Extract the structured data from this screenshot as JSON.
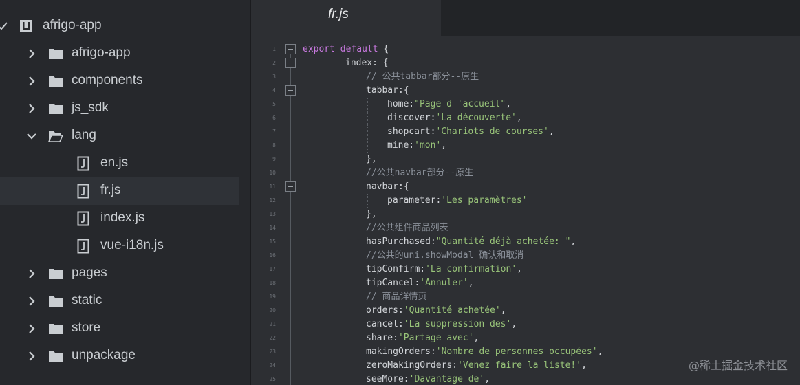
{
  "sidebar": {
    "items": [
      {
        "label": "afrigo-app",
        "type": "project",
        "chevron": "check",
        "depth": 0
      },
      {
        "label": "afrigo-app",
        "type": "folder",
        "chevron": "right",
        "depth": 1
      },
      {
        "label": "components",
        "type": "folder",
        "chevron": "right",
        "depth": 1
      },
      {
        "label": "js_sdk",
        "type": "folder",
        "chevron": "right",
        "depth": 1
      },
      {
        "label": "lang",
        "type": "folder-open",
        "chevron": "down",
        "depth": 1
      },
      {
        "label": "en.js",
        "type": "file",
        "chevron": "none",
        "depth": 2
      },
      {
        "label": "fr.js",
        "type": "file",
        "chevron": "none",
        "depth": 2,
        "selected": true
      },
      {
        "label": "index.js",
        "type": "file",
        "chevron": "none",
        "depth": 2
      },
      {
        "label": "vue-i18n.js",
        "type": "file",
        "chevron": "none",
        "depth": 2
      },
      {
        "label": "pages",
        "type": "folder",
        "chevron": "right",
        "depth": 1
      },
      {
        "label": "static",
        "type": "folder",
        "chevron": "right",
        "depth": 1
      },
      {
        "label": "store",
        "type": "folder",
        "chevron": "right",
        "depth": 1
      },
      {
        "label": "unpackage",
        "type": "folder",
        "chevron": "right",
        "depth": 1
      }
    ]
  },
  "tab": {
    "title": "fr.js"
  },
  "editor": {
    "lines": [
      {
        "n": "1",
        "indent": 0,
        "fold": "open",
        "parts": [
          {
            "t": "export default",
            "c": "kw"
          },
          {
            "t": " {",
            "c": "pl"
          }
        ]
      },
      {
        "n": "2",
        "indent": 1,
        "fold": "open",
        "parts": [
          {
            "t": "index: {",
            "c": "pl"
          }
        ]
      },
      {
        "n": "3",
        "indent": 2,
        "fold": "",
        "parts": [
          {
            "t": "// 公共tabbar部分--原生",
            "c": "cm"
          }
        ]
      },
      {
        "n": "4",
        "indent": 2,
        "fold": "open",
        "parts": [
          {
            "t": "tabbar:{",
            "c": "pl"
          }
        ]
      },
      {
        "n": "5",
        "indent": 3,
        "fold": "",
        "parts": [
          {
            "t": "home:",
            "c": "pl"
          },
          {
            "t": "\"Page d 'accueil\"",
            "c": "str"
          },
          {
            "t": ",",
            "c": "pl"
          }
        ]
      },
      {
        "n": "6",
        "indent": 3,
        "fold": "",
        "parts": [
          {
            "t": "discover:",
            "c": "pl"
          },
          {
            "t": "'La découverte'",
            "c": "str"
          },
          {
            "t": ",",
            "c": "pl"
          }
        ]
      },
      {
        "n": "7",
        "indent": 3,
        "fold": "",
        "parts": [
          {
            "t": "shopcart:",
            "c": "pl"
          },
          {
            "t": "'Chariots de courses'",
            "c": "str"
          },
          {
            "t": ",",
            "c": "pl"
          }
        ]
      },
      {
        "n": "8",
        "indent": 3,
        "fold": "",
        "parts": [
          {
            "t": "mine:",
            "c": "pl"
          },
          {
            "t": "'mon'",
            "c": "str"
          },
          {
            "t": ",",
            "c": "pl"
          }
        ]
      },
      {
        "n": "9",
        "indent": 2,
        "fold": "end",
        "parts": [
          {
            "t": "},",
            "c": "pl"
          }
        ]
      },
      {
        "n": "10",
        "indent": 2,
        "fold": "",
        "parts": [
          {
            "t": "//公共navbar部分--原生",
            "c": "cm"
          }
        ]
      },
      {
        "n": "11",
        "indent": 2,
        "fold": "open",
        "parts": [
          {
            "t": "navbar:{",
            "c": "pl"
          }
        ]
      },
      {
        "n": "12",
        "indent": 3,
        "fold": "",
        "parts": [
          {
            "t": "parameter:",
            "c": "pl"
          },
          {
            "t": "'Les paramètres'",
            "c": "str"
          }
        ]
      },
      {
        "n": "13",
        "indent": 2,
        "fold": "end",
        "parts": [
          {
            "t": "},",
            "c": "pl"
          }
        ]
      },
      {
        "n": "14",
        "indent": 2,
        "fold": "",
        "parts": [
          {
            "t": "//公共组件商品列表",
            "c": "cm"
          }
        ]
      },
      {
        "n": "15",
        "indent": 2,
        "fold": "",
        "parts": [
          {
            "t": "hasPurchased:",
            "c": "pl"
          },
          {
            "t": "\"Quantité déjà achetée: \"",
            "c": "str"
          },
          {
            "t": ",",
            "c": "pl"
          }
        ]
      },
      {
        "n": "16",
        "indent": 2,
        "fold": "",
        "parts": [
          {
            "t": "//公共的uni.showModal 确认和取消",
            "c": "cm"
          }
        ]
      },
      {
        "n": "17",
        "indent": 2,
        "fold": "",
        "parts": [
          {
            "t": "tipConfirm:",
            "c": "pl"
          },
          {
            "t": "'La confirmation'",
            "c": "str"
          },
          {
            "t": ",",
            "c": "pl"
          }
        ]
      },
      {
        "n": "18",
        "indent": 2,
        "fold": "",
        "parts": [
          {
            "t": "tipCancel:",
            "c": "pl"
          },
          {
            "t": "'Annuler'",
            "c": "str"
          },
          {
            "t": ",",
            "c": "pl"
          }
        ]
      },
      {
        "n": "19",
        "indent": 2,
        "fold": "",
        "parts": [
          {
            "t": "// 商品详情页",
            "c": "cm"
          }
        ]
      },
      {
        "n": "20",
        "indent": 2,
        "fold": "",
        "parts": [
          {
            "t": "orders:",
            "c": "pl"
          },
          {
            "t": "'Quantité achetée'",
            "c": "str"
          },
          {
            "t": ",",
            "c": "pl"
          }
        ]
      },
      {
        "n": "21",
        "indent": 2,
        "fold": "",
        "parts": [
          {
            "t": "cancel:",
            "c": "pl"
          },
          {
            "t": "'La suppression des'",
            "c": "str"
          },
          {
            "t": ",",
            "c": "pl"
          }
        ]
      },
      {
        "n": "22",
        "indent": 2,
        "fold": "",
        "parts": [
          {
            "t": "share:",
            "c": "pl"
          },
          {
            "t": "'Partage avec'",
            "c": "str"
          },
          {
            "t": ",",
            "c": "pl"
          }
        ]
      },
      {
        "n": "23",
        "indent": 2,
        "fold": "",
        "parts": [
          {
            "t": "makingOrders:",
            "c": "pl"
          },
          {
            "t": "'Nombre de personnes occupées'",
            "c": "str"
          },
          {
            "t": ",",
            "c": "pl"
          }
        ]
      },
      {
        "n": "24",
        "indent": 2,
        "fold": "",
        "parts": [
          {
            "t": "zeroMakingOrders:",
            "c": "pl"
          },
          {
            "t": "'Venez faire la liste!'",
            "c": "str"
          },
          {
            "t": ",",
            "c": "pl"
          }
        ]
      },
      {
        "n": "25",
        "indent": 2,
        "fold": "",
        "parts": [
          {
            "t": "seeMore:",
            "c": "pl"
          },
          {
            "t": "'Davantage de'",
            "c": "str"
          },
          {
            "t": ",",
            "c": "pl"
          }
        ]
      }
    ]
  },
  "watermark": "@稀土掘金技术社区",
  "colors": {
    "keyword": "#c678dd",
    "string": "#98c379",
    "comment": "#8a9099",
    "text": "#d1d4d8"
  }
}
